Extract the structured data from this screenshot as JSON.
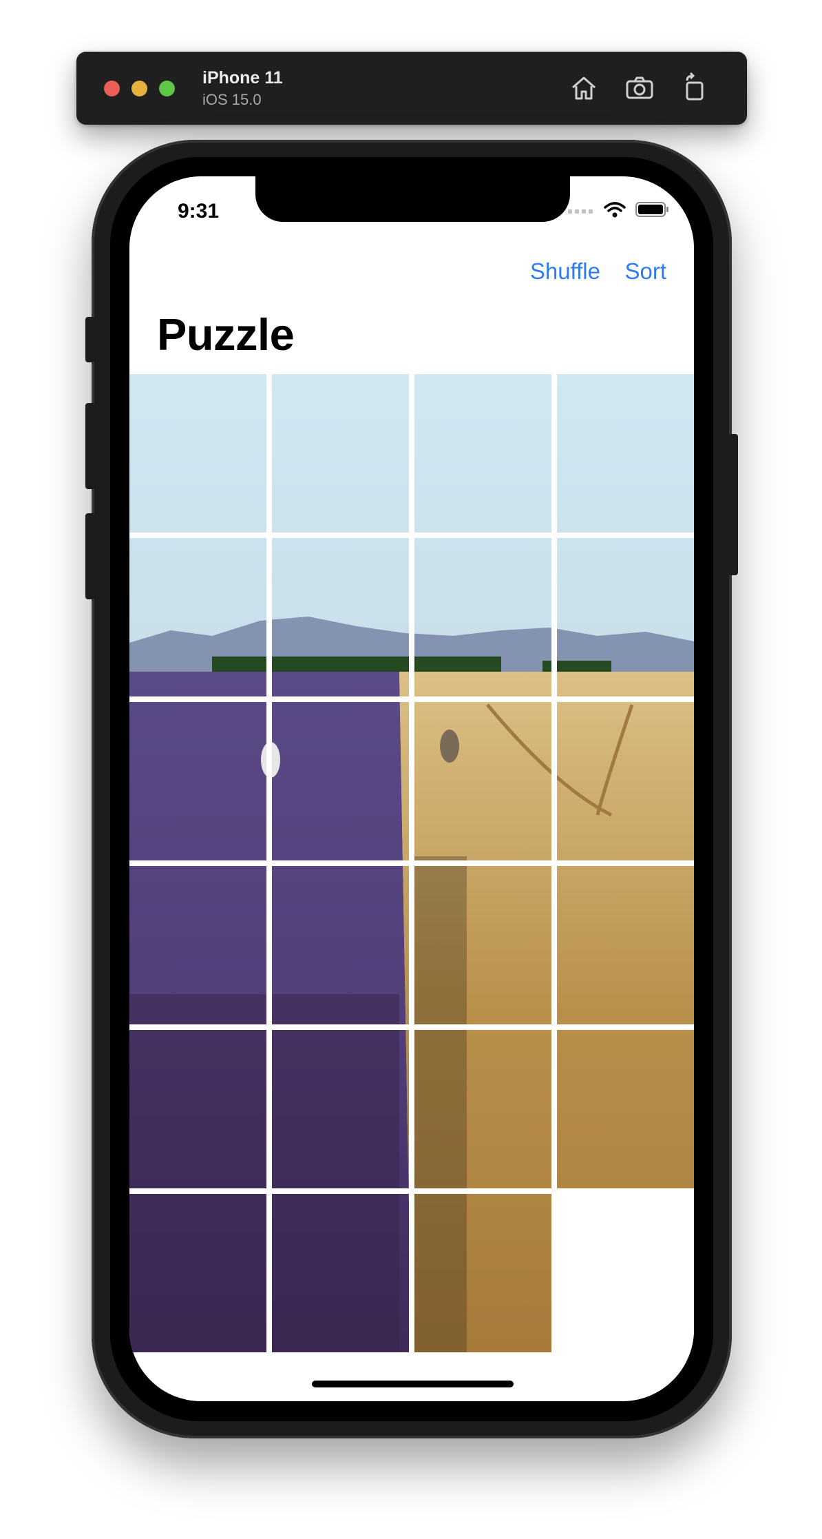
{
  "toolbar": {
    "device_name": "iPhone 11",
    "os_version": "iOS 15.0",
    "icons": [
      "home-icon",
      "screenshot-icon",
      "rotate-icon"
    ]
  },
  "status_bar": {
    "time": "9:31",
    "icons": [
      "signal-icon",
      "wifi-icon",
      "battery-icon"
    ]
  },
  "nav": {
    "shuffle_label": "Shuffle",
    "sort_label": "Sort"
  },
  "title": "Puzzle",
  "puzzle": {
    "columns": 4,
    "rows": 6,
    "tile_count": 24,
    "tiles": [
      {
        "col": 0,
        "row": 0
      },
      {
        "col": 1,
        "row": 0
      },
      {
        "col": 2,
        "row": 0
      },
      {
        "col": 3,
        "row": 0
      },
      {
        "col": 0,
        "row": 1
      },
      {
        "col": 1,
        "row": 1
      },
      {
        "col": 2,
        "row": 1
      },
      {
        "col": 3,
        "row": 1
      },
      {
        "col": 0,
        "row": 2
      },
      {
        "col": 1,
        "row": 2
      },
      {
        "col": 2,
        "row": 2
      },
      {
        "col": 3,
        "row": 2
      },
      {
        "col": 0,
        "row": 3
      },
      {
        "col": 1,
        "row": 3
      },
      {
        "col": 2,
        "row": 3
      },
      {
        "col": 3,
        "row": 3
      },
      {
        "col": 0,
        "row": 4
      },
      {
        "col": 1,
        "row": 4
      },
      {
        "col": 2,
        "row": 4
      },
      {
        "col": 3,
        "row": 4
      },
      {
        "col": 0,
        "row": 5
      },
      {
        "col": 1,
        "row": 5
      },
      {
        "col": 2,
        "row": 5
      },
      {
        "col": 3,
        "row": 5,
        "empty": true
      }
    ],
    "image_description": "lavender and wheat field landscape"
  },
  "colors": {
    "accent": "#2f7bf5",
    "toolbar_bg": "#1f1f1f",
    "close": "#ec5f57",
    "minimize": "#e6b13e",
    "zoom": "#5fc646"
  }
}
